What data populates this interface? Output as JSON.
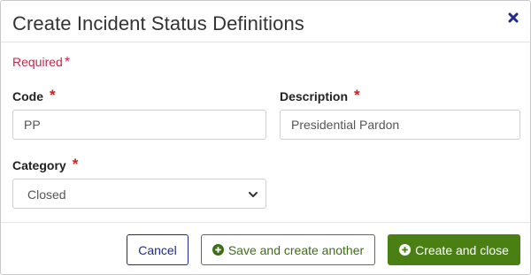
{
  "dialog": {
    "title": "Create Incident Status Definitions",
    "close_icon": "close-x-icon"
  },
  "form": {
    "required_note": "Required",
    "required_marker": "*",
    "code": {
      "label": "Code",
      "value": "PP"
    },
    "description": {
      "label": "Description",
      "value": "Presidential Pardon"
    },
    "category": {
      "label": "Category",
      "selected": "Closed",
      "icon": "chevron-down-icon"
    }
  },
  "footer": {
    "cancel_label": "Cancel",
    "save_another_label": "Save and create another",
    "create_close_label": "Create and close",
    "plus_icon": "plus-circle-icon"
  },
  "colors": {
    "required_text": "#c4284f",
    "required_star": "#cc1f1f",
    "cancel_border": "#1f2a8a",
    "primary_green": "#4a7f14",
    "close_icon": "#1f2a8a"
  }
}
